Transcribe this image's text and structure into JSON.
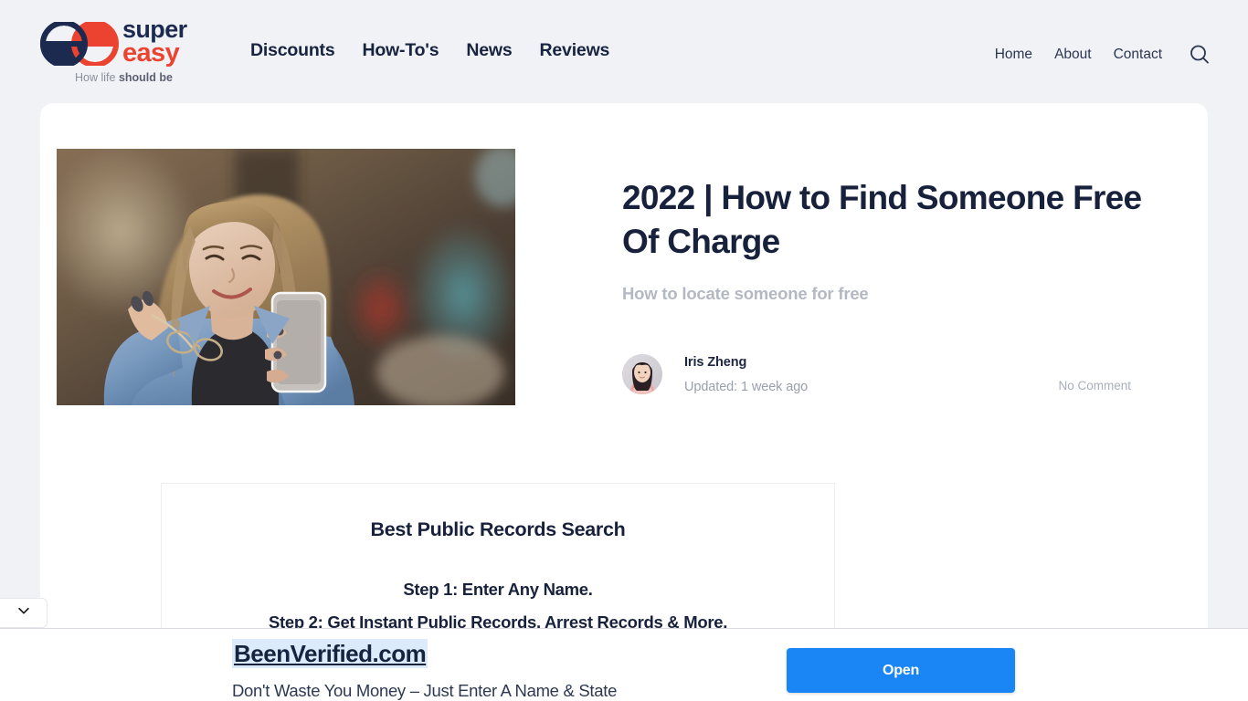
{
  "header": {
    "logo": {
      "word_primary": "super",
      "word_secondary": "easy",
      "tagline_light": "How life ",
      "tagline_bold": "should be",
      "color_navy": "#1b2a4e",
      "color_red": "#ec4331"
    },
    "main_nav": [
      {
        "label": "Discounts"
      },
      {
        "label": "How-To's"
      },
      {
        "label": "News"
      },
      {
        "label": "Reviews"
      }
    ],
    "utility_nav": [
      {
        "label": "Home"
      },
      {
        "label": "About"
      },
      {
        "label": "Contact"
      }
    ],
    "search_icon": "search-icon"
  },
  "article": {
    "title": "2022 | How to Find Someone Free Of Charge",
    "subtitle": "How to locate someone for free",
    "hero_image_alt": "woman in denim jacket smiling at her smartphone",
    "author": {
      "name": "Iris Zheng",
      "updated": "Updated: 1 week ago",
      "avatar_alt": "portrait of Iris Zheng"
    },
    "comments": "No Comment"
  },
  "promo": {
    "title": "Best Public Records Search",
    "steps": [
      "Step 1: Enter Any Name.",
      "Step 2: Get Instant Public Records, Arrest Records & More."
    ]
  },
  "edge_tab": {
    "icon": "chevron-down-icon"
  },
  "ad": {
    "headline": "BeenVerified.com",
    "subtext": "Don't Waste You Money – Just Enter A Name & State",
    "button_label": "Open",
    "button_color": "#1a85f5",
    "headline_highlight_color": "#dcebfb"
  }
}
